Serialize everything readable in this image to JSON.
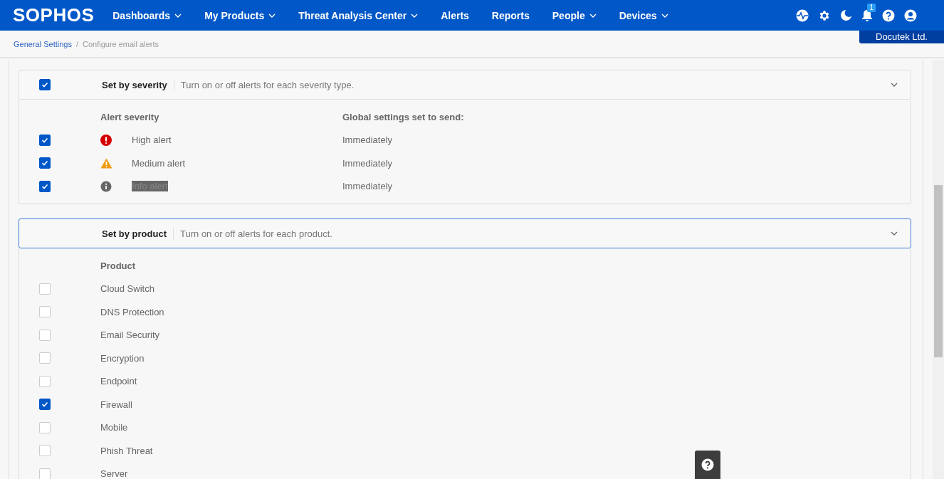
{
  "nav": {
    "logo": "SOPHOS",
    "items": [
      {
        "label": "Dashboards",
        "has_menu": true
      },
      {
        "label": "My Products",
        "has_menu": true
      },
      {
        "label": "Threat Analysis Center",
        "has_menu": true
      },
      {
        "label": "Alerts",
        "has_menu": false
      },
      {
        "label": "Reports",
        "has_menu": false
      },
      {
        "label": "People",
        "has_menu": true
      },
      {
        "label": "Devices",
        "has_menu": true
      }
    ],
    "notification_count": "1",
    "account": "Docutek Ltd."
  },
  "breadcrumb_separator": "/",
  "breadcrumb": [
    {
      "label": "General Settings",
      "link": true
    },
    {
      "label": "Configure email alerts",
      "link": false
    }
  ],
  "sections": [
    {
      "title": "Set by severity",
      "description": "Turn on or off alerts for each severity type.",
      "header_checked": true,
      "focused": false,
      "expanded": true,
      "columns": [
        "Alert severity",
        "Global settings set to send:"
      ],
      "rows": [
        {
          "kind": "high",
          "checked": true,
          "label": "High alert",
          "send": "Immediately",
          "redacted": false
        },
        {
          "kind": "medium",
          "checked": true,
          "label": "Medium alert",
          "send": "Immediately",
          "redacted": false
        },
        {
          "kind": "info",
          "checked": true,
          "label": "Info alert",
          "send": "Immediately",
          "redacted": true
        }
      ]
    },
    {
      "title": "Set by product",
      "description": "Turn on or off alerts for each product.",
      "focused": true,
      "expanded": true,
      "columns": [
        "Product"
      ],
      "rows": [
        {
          "kind": "plain",
          "checked": false,
          "label": "Cloud Switch"
        },
        {
          "kind": "plain",
          "checked": false,
          "label": "DNS Protection"
        },
        {
          "kind": "plain",
          "checked": false,
          "label": "Email Security"
        },
        {
          "kind": "plain",
          "checked": false,
          "label": "Encryption"
        },
        {
          "kind": "plain",
          "checked": false,
          "label": "Endpoint"
        },
        {
          "kind": "plain",
          "checked": true,
          "label": "Firewall"
        },
        {
          "kind": "plain",
          "checked": false,
          "label": "Mobile"
        },
        {
          "kind": "plain",
          "checked": false,
          "label": "Phish Threat"
        },
        {
          "kind": "plain",
          "checked": false,
          "label": "Server"
        }
      ]
    }
  ]
}
